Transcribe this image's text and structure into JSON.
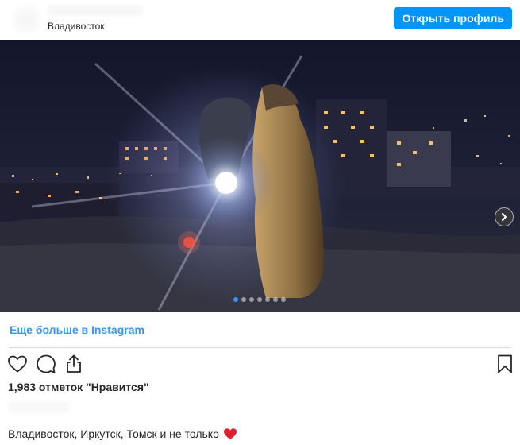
{
  "header": {
    "location": "Владивосток",
    "open_profile_label": "Открыть профиль"
  },
  "carousel": {
    "total_slides": 7,
    "current_slide": 1
  },
  "more_link": "Еще больше в Instagram",
  "actions": {
    "icons": [
      "heart-icon",
      "comment-icon",
      "share-icon",
      "bookmark-icon"
    ]
  },
  "likes_text": "1,983 отметок \"Нравится\"",
  "caption": {
    "text": "Владивосток, Иркутск, Томск и не только",
    "emoji_icon": "red-heart-icon"
  },
  "colors": {
    "accent": "#0095f6",
    "link": "#3897f0",
    "heart": "#e0202e",
    "active_dot": "#3797f0"
  }
}
